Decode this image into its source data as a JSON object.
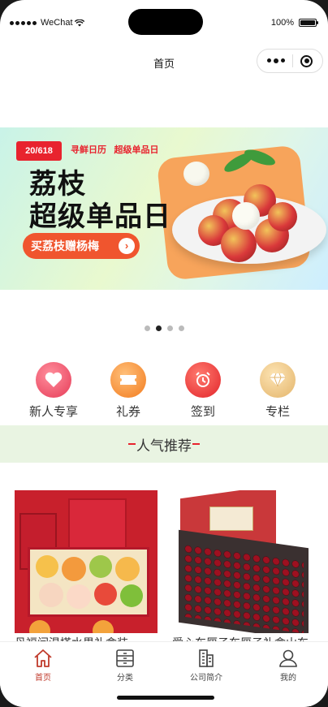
{
  "status_bar": {
    "carrier": "WeChat",
    "battery": "100%"
  },
  "nav": {
    "title": "首页"
  },
  "banner": {
    "badge": "20/618",
    "logo_left": "寻鲜日历",
    "logo_right": "超级单品日",
    "headline_line1": "荔枝",
    "headline_line2": "超级单品日",
    "button_label": "买荔枝赠杨梅",
    "page_count": 4,
    "active_page": 2
  },
  "quick_links": [
    {
      "label": "新人专享",
      "icon": "heart-icon",
      "color": "#f0566a"
    },
    {
      "label": "礼券",
      "icon": "ticket-icon",
      "color": "#f58a2a"
    },
    {
      "label": "签到",
      "icon": "alarm-clock-icon",
      "color": "#ea3b3b"
    },
    {
      "label": "专栏",
      "icon": "diamond-icon",
      "color": "#e8c07a"
    }
  ],
  "section": {
    "title": "人气推荐"
  },
  "products": [
    {
      "name": "丹福闫温搭水果礼盒装",
      "image": "fruit-gift-box"
    },
    {
      "name": "爱心车厘子车厘子礼盒山东",
      "image": "cherry-gift-box"
    }
  ],
  "tabbar": [
    {
      "label": "首页",
      "icon": "home-icon",
      "active": true
    },
    {
      "label": "分类",
      "icon": "category-icon",
      "active": false
    },
    {
      "label": "公司简介",
      "icon": "building-icon",
      "active": false
    },
    {
      "label": "我的",
      "icon": "user-icon",
      "active": false
    }
  ],
  "colors": {
    "accent": "#c03a2b",
    "section_bg": "#e9f4e2"
  }
}
